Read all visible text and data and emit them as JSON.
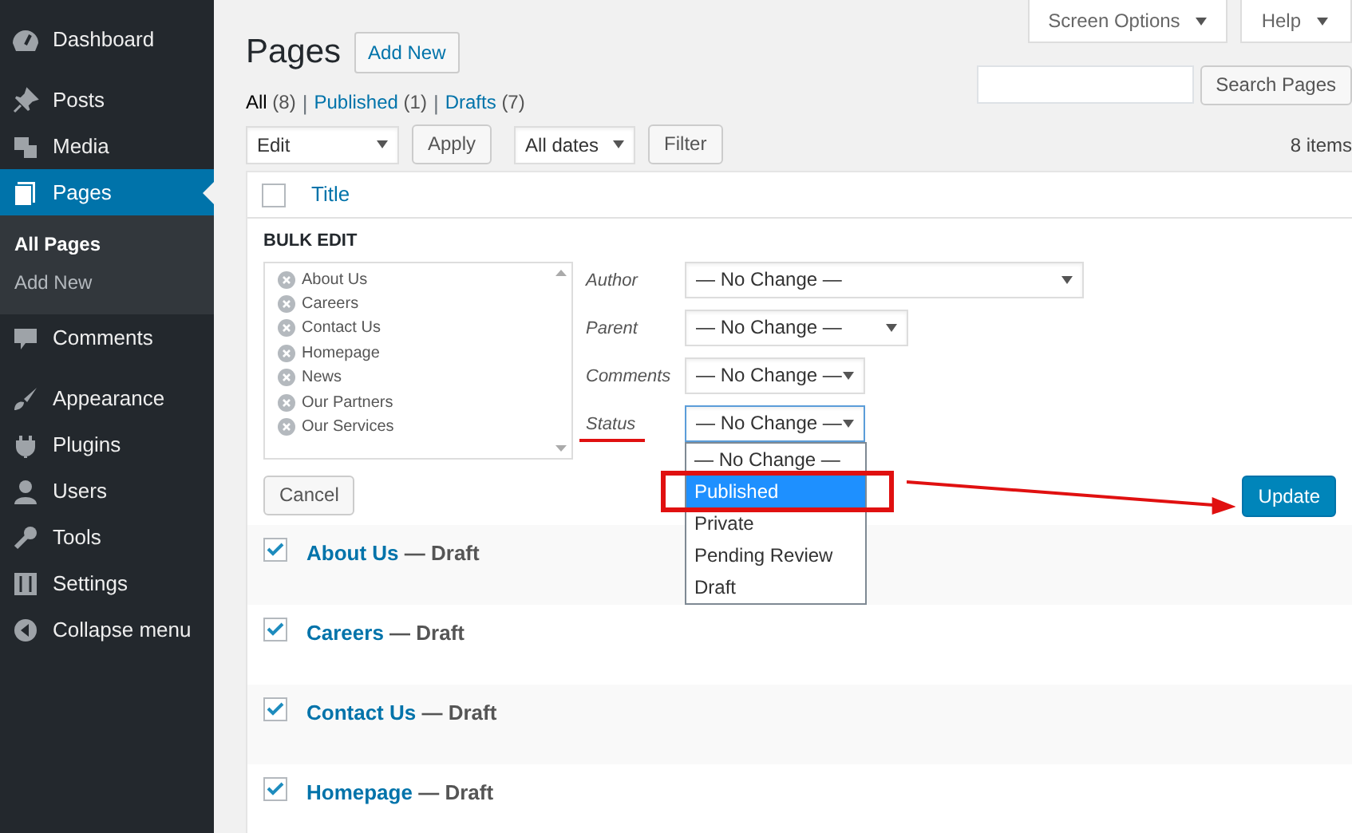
{
  "sidebar": {
    "sections": [
      {
        "items": [
          {
            "label": "Dashboard",
            "selected": false
          }
        ]
      },
      {
        "items": [
          {
            "label": "Posts",
            "selected": false
          },
          {
            "label": "Media",
            "selected": false
          },
          {
            "label": "Pages",
            "selected": true,
            "children": [
              {
                "label": "All Pages",
                "selected": true
              },
              {
                "label": "Add New",
                "selected": false
              }
            ]
          },
          {
            "label": "Comments",
            "selected": false
          }
        ]
      },
      {
        "items": [
          {
            "label": "Appearance",
            "selected": false
          },
          {
            "label": "Plugins",
            "selected": false
          },
          {
            "label": "Users",
            "selected": false
          },
          {
            "label": "Tools",
            "selected": false
          },
          {
            "label": "Settings",
            "selected": false
          },
          {
            "label": "Collapse menu",
            "selected": false
          }
        ]
      }
    ]
  },
  "header": {
    "title": "Pages",
    "add_new": "Add New",
    "screen_options": "Screen Options",
    "help": "Help"
  },
  "filter_separator": "|",
  "filters": [
    {
      "label": "All",
      "count": "(8)",
      "selected": true
    },
    {
      "label": "Published",
      "count": "(1)",
      "selected": false
    },
    {
      "label": "Drafts",
      "count": "(7)",
      "selected": false
    }
  ],
  "search": {
    "button": "Search Pages"
  },
  "toolbar": {
    "bulk_action": "Edit",
    "apply": "Apply",
    "dates": "All dates",
    "filter": "Filter",
    "items": "8 items"
  },
  "table": {
    "column": "Title",
    "checked": false
  },
  "bulk_edit": {
    "title": "BULK EDIT",
    "pages": [
      "About Us",
      "Careers",
      "Contact Us",
      "Homepage",
      "News",
      "Our Partners",
      "Our Services"
    ],
    "fields": [
      {
        "label": "Author",
        "value": "— No Change —",
        "open": false
      },
      {
        "label": "Parent",
        "value": "— No Change —",
        "open": false
      },
      {
        "label": "Comments",
        "value": "— No Change —",
        "open": false
      },
      {
        "label": "Status",
        "value": "— No Change —",
        "open": true
      }
    ],
    "status_options": [
      {
        "label": "— No Change —",
        "selected": false
      },
      {
        "label": "Published",
        "selected": true
      },
      {
        "label": "Private",
        "selected": false
      },
      {
        "label": "Pending Review",
        "selected": false
      },
      {
        "label": "Draft",
        "selected": false
      }
    ],
    "cancel": "Cancel",
    "update": "Update"
  },
  "rows": [
    {
      "title": "About Us",
      "state": "— Draft",
      "checked": true
    },
    {
      "title": "Careers",
      "state": "— Draft",
      "checked": true
    },
    {
      "title": "Contact Us",
      "state": "— Draft",
      "checked": true
    },
    {
      "title": "Homepage",
      "state": "— Draft",
      "checked": true
    }
  ]
}
